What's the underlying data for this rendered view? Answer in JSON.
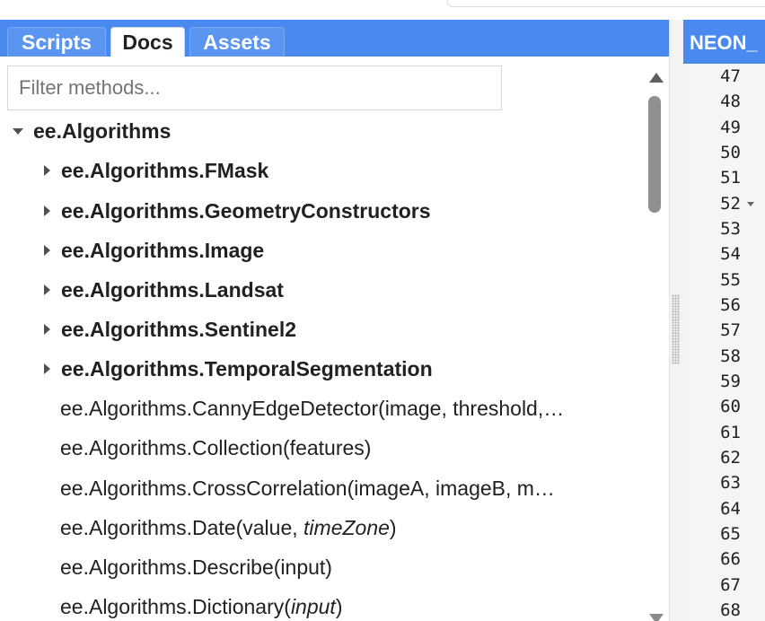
{
  "tabs": [
    {
      "label": "Scripts",
      "active": false
    },
    {
      "label": "Docs",
      "active": true
    },
    {
      "label": "Assets",
      "active": false
    }
  ],
  "filter": {
    "placeholder": "Filter methods...",
    "value": ""
  },
  "tree": {
    "root": {
      "label": "ee.Algorithms",
      "expanded": true
    },
    "groups": [
      {
        "label": "ee.Algorithms.FMask"
      },
      {
        "label": "ee.Algorithms.GeometryConstructors"
      },
      {
        "label": "ee.Algorithms.Image"
      },
      {
        "label": "ee.Algorithms.Landsat"
      },
      {
        "label": "ee.Algorithms.Sentinel2"
      },
      {
        "label": "ee.Algorithms.TemporalSegmentation"
      }
    ],
    "methods": [
      {
        "name": "ee.Algorithms.CannyEdgeDetector",
        "args": "(image, threshold,…",
        "optional": "",
        "close": ""
      },
      {
        "name": "ee.Algorithms.Collection",
        "args": "(features)",
        "optional": "",
        "close": ""
      },
      {
        "name": "ee.Algorithms.CrossCorrelation",
        "args": "(imageA, imageB, m…",
        "optional": "",
        "close": ""
      },
      {
        "name": "ee.Algorithms.Date",
        "args": "(value, ",
        "optional": "timeZone",
        "close": ")"
      },
      {
        "name": "ee.Algorithms.Describe",
        "args": "(input)",
        "optional": "",
        "close": ""
      },
      {
        "name": "ee.Algorithms.Dictionary",
        "args": "(",
        "optional": "input",
        "close": ")"
      }
    ]
  },
  "editor": {
    "file_tab": "NEON_",
    "line_numbers": [
      "47",
      "48",
      "49",
      "50",
      "51",
      "52",
      "53",
      "54",
      "55",
      "56",
      "57",
      "58",
      "59",
      "60",
      "61",
      "62",
      "63",
      "64",
      "65",
      "66",
      "67",
      "68"
    ],
    "fold_line": "52"
  },
  "colors": {
    "accent": "#4a89f0",
    "text": "#202124"
  },
  "icons": {
    "collapse": "triangle-down-icon",
    "expand": "triangle-right-icon",
    "scroll_up": "scroll-up-arrow-icon",
    "scroll_down": "scroll-down-arrow-icon",
    "fold": "fold-chevron-icon"
  }
}
